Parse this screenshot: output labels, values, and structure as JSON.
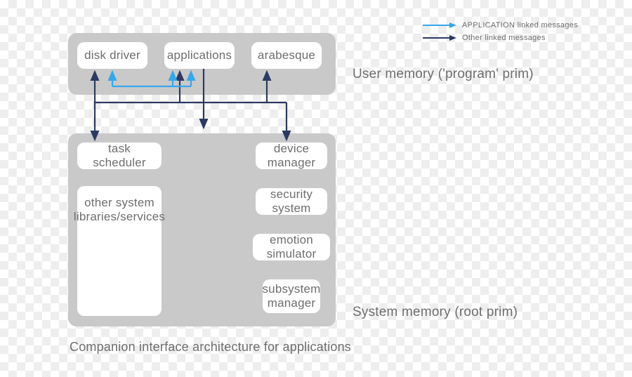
{
  "diagram": {
    "caption": "Companion interface architecture for applications",
    "user_memory": {
      "label": "User memory ('program' prim)",
      "nodes": {
        "disk_driver": "disk driver",
        "applications": "applications",
        "arabesque": "arabesque"
      }
    },
    "system_memory": {
      "label": "System memory (root prim)",
      "nodes": {
        "task_scheduler": "task scheduler",
        "other_libs": "other system libraries/services",
        "device_manager": "device manager",
        "security_system": "security system",
        "emotion_simulator": "emotion simulator",
        "subsystem_manager": "subsystem manager"
      }
    },
    "legend": {
      "app_linked_strong": "APPLICATION",
      "app_linked_rest": " linked messages",
      "other_linked": "Other linked messages"
    },
    "colors": {
      "app_arrow": "#36a7ea",
      "other_arrow": "#2c3a63",
      "panel": "#c9c9c9",
      "text": "#6d6d6d"
    }
  }
}
